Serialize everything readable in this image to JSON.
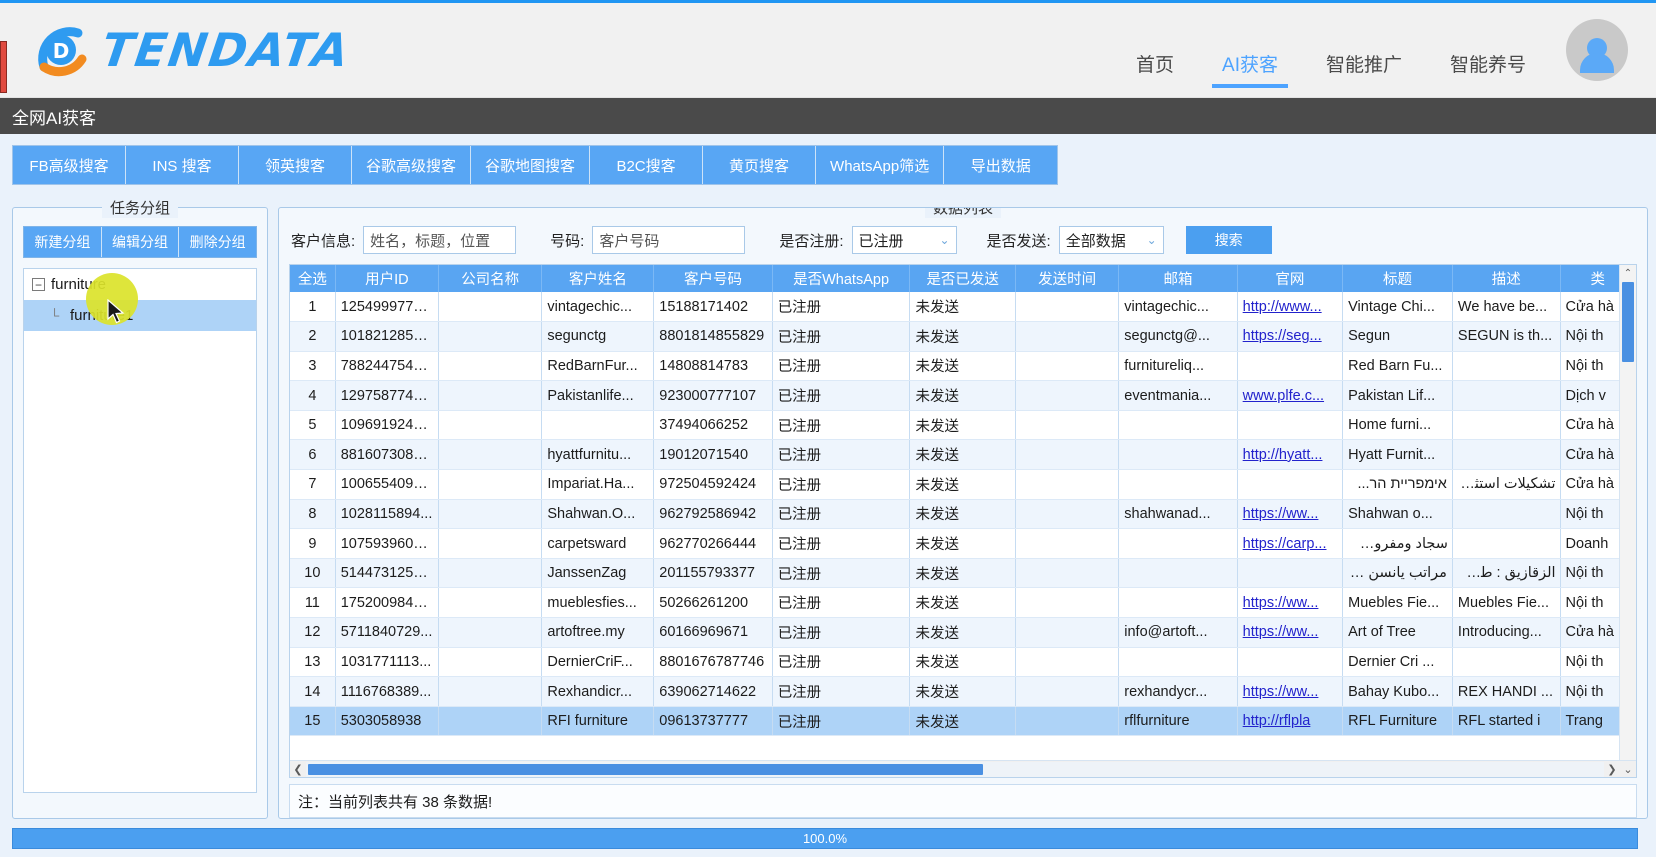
{
  "brand": {
    "name": "TENDATA",
    "logo_icon": "tendata-logo-icon"
  },
  "header": {
    "nav": [
      {
        "label": "首页",
        "active": false
      },
      {
        "label": "AI获客",
        "active": true
      },
      {
        "label": "智能推广",
        "active": false
      },
      {
        "label": "智能养号",
        "active": false
      }
    ],
    "avatar_icon": "user-avatar-icon"
  },
  "subbar": {
    "title": "全网AI获客"
  },
  "toolbar": {
    "buttons": [
      "FB高级搜客",
      "INS 搜客",
      "领英搜客",
      "谷歌高级搜客",
      "谷歌地图搜客",
      "B2C搜客",
      "黄页搜客",
      "WhatsApp筛选",
      "导出数据"
    ]
  },
  "left_panel": {
    "title": "任务分组",
    "buttons": [
      "新建分组",
      "编辑分组",
      "删除分组"
    ],
    "tree": [
      {
        "label": "furniture",
        "level": 0,
        "expanded": true,
        "selected": false,
        "toggle": "−"
      },
      {
        "label": "furniture1",
        "level": 1,
        "expanded": false,
        "selected": true,
        "toggle": ""
      }
    ]
  },
  "right_panel": {
    "title": "数据列表",
    "filters": {
      "customer_info_label": "客户信息:",
      "customer_info_placeholder": "姓名，标题，位置",
      "customer_info_value": "",
      "number_label": "号码:",
      "number_placeholder": "客户号码",
      "number_value": "",
      "registered_label": "是否注册:",
      "registered_value": "已注册",
      "sent_label": "是否发送:",
      "sent_value": "全部数据",
      "search_button": "搜索",
      "chevron_icon": "chevron-down-icon"
    },
    "columns": [
      "全选",
      "用户ID",
      "公司名称",
      "客户姓名",
      "客户号码",
      "是否WhatsApp",
      "是否已发送",
      "发送时间",
      "邮箱",
      "官网",
      "标题",
      "描述",
      "类"
    ],
    "rows": [
      {
        "idx": "1",
        "user_id": "1254999774...",
        "company": "",
        "name": "vintagechic...",
        "phone": "15188171402",
        "whatsapp": "已注册",
        "sent": "未发送",
        "send_time": "",
        "email": "vintagechic...",
        "site": "http://www...",
        "title": "Vintage Chi...",
        "desc": "We have be...",
        "cat": "Cửa hà",
        "selected": false
      },
      {
        "idx": "2",
        "user_id": "1018212852...",
        "company": "",
        "name": "segunctg",
        "phone": "8801814855829",
        "whatsapp": "已注册",
        "sent": "未发送",
        "send_time": "",
        "email": "segunctg@...",
        "site": "https://seg...",
        "title": "Segun",
        "desc": "SEGUN is th...",
        "cat": "Nội th",
        "selected": false
      },
      {
        "idx": "3",
        "user_id": "7882447549...",
        "company": "",
        "name": "RedBarnFur...",
        "phone": "14808814783",
        "whatsapp": "已注册",
        "sent": "未发送",
        "send_time": "",
        "email": "furnitureliq...",
        "site": "",
        "title": "Red Barn Fu...",
        "desc": "",
        "cat": "Nội th",
        "selected": false
      },
      {
        "idx": "4",
        "user_id": "1297587743...",
        "company": "",
        "name": "Pakistanlife...",
        "phone": "923000777107",
        "whatsapp": "已注册",
        "sent": "未发送",
        "send_time": "",
        "email": "eventmania...",
        "site": "www.plfe.c...",
        "title": "Pakistan Lif...",
        "desc": "",
        "cat": "Dịch v",
        "selected": false
      },
      {
        "idx": "5",
        "user_id": "1096919241...",
        "company": "",
        "name": "",
        "phone": "37494066252",
        "whatsapp": "已注册",
        "sent": "未发送",
        "send_time": "",
        "email": "",
        "site": "",
        "title": "Home furni...",
        "desc": "",
        "cat": "Cửa hà",
        "selected": false
      },
      {
        "idx": "6",
        "user_id": "8816073086...",
        "company": "",
        "name": "hyattfurnitu...",
        "phone": "19012071540",
        "whatsapp": "已注册",
        "sent": "未发送",
        "send_time": "",
        "email": "",
        "site": "http://hyatt...",
        "title": "Hyatt Furnit...",
        "desc": "",
        "cat": "Cửa hà",
        "selected": false
      },
      {
        "idx": "7",
        "user_id": "1006554090...",
        "company": "",
        "name": "Impariat.Ha...",
        "phone": "972504592424",
        "whatsapp": "已注册",
        "sent": "未发送",
        "send_time": "",
        "email": "",
        "site": "",
        "title": "אימפריית הר...",
        "desc": "تشكيلات استثنائية ...",
        "cat": "Cửa hà",
        "selected": false
      },
      {
        "idx": "8",
        "user_id": "1028115894...",
        "company": "",
        "name": "Shahwan.O...",
        "phone": "962792586942",
        "whatsapp": "已注册",
        "sent": "未发送",
        "send_time": "",
        "email": "shahwanad...",
        "site": "https://ww...",
        "title": "Shahwan o...",
        "desc": "",
        "cat": "Nội th",
        "selected": false
      },
      {
        "idx": "9",
        "user_id": "1075939606...",
        "company": "",
        "name": "carpetsward",
        "phone": "962770266444",
        "whatsapp": "已注册",
        "sent": "未发送",
        "send_time": "",
        "email": "",
        "site": "https://carp...",
        "title": "سجاد ومفروشات ...",
        "desc": "",
        "cat": "Doanh",
        "selected": false
      },
      {
        "idx": "10",
        "user_id": "5144731252...",
        "company": "",
        "name": "JanssenZag",
        "phone": "201155793377",
        "whatsapp": "已注册",
        "sent": "未发送",
        "send_time": "",
        "email": "",
        "site": "",
        "title": "مراتب يانسن توك...",
        "desc": "الزقازيق : طريق ...",
        "cat": "Nội th",
        "selected": false
      },
      {
        "idx": "11",
        "user_id": "1752009841...",
        "company": "",
        "name": "mueblesfies...",
        "phone": "50266261200",
        "whatsapp": "已注册",
        "sent": "未发送",
        "send_time": "",
        "email": "",
        "site": "https://ww...",
        "title": "Muebles Fie...",
        "desc": "Muebles Fie...",
        "cat": "Nội th",
        "selected": false
      },
      {
        "idx": "12",
        "user_id": "5711840729...",
        "company": "",
        "name": "artoftree.my",
        "phone": "60166969671",
        "whatsapp": "已注册",
        "sent": "未发送",
        "send_time": "",
        "email": "info@artoft...",
        "site": "https://ww...",
        "title": "Art of Tree",
        "desc": "Introducing...",
        "cat": "Cửa hà",
        "selected": false
      },
      {
        "idx": "13",
        "user_id": "1031771113...",
        "company": "",
        "name": "DernierCriF...",
        "phone": "8801676787746",
        "whatsapp": "已注册",
        "sent": "未发送",
        "send_time": "",
        "email": "",
        "site": "",
        "title": "Dernier Cri ...",
        "desc": "",
        "cat": "Nội th",
        "selected": false
      },
      {
        "idx": "14",
        "user_id": "1116768389...",
        "company": "",
        "name": "Rexhandicr...",
        "phone": "639062714622",
        "whatsapp": "已注册",
        "sent": "未发送",
        "send_time": "",
        "email": "rexhandycr...",
        "site": "https://ww...",
        "title": "Bahay Kubo...",
        "desc": "REX HANDI ...",
        "cat": "Nội th",
        "selected": false
      },
      {
        "idx": "15",
        "user_id": "5303058938",
        "company": "",
        "name": "RFI furniture",
        "phone": "09613737777",
        "whatsapp": "已注册",
        "sent": "未发送",
        "send_time": "",
        "email": "rflfurniture",
        "site": "http://rflpla",
        "title": "RFL Furniture",
        "desc": "RFL started i",
        "cat": "Trang",
        "selected": true
      }
    ],
    "note": "注：当前列表共有 38 条数据!",
    "scrollbar": {
      "h_left_icon": "chevron-left-icon",
      "h_right_icon": "chevron-right-icon",
      "v_up_icon": "chevron-up-icon",
      "v_down_icon": "chevron-down-icon"
    }
  },
  "progress": {
    "label": "100.0%",
    "percent": 100,
    "color": "#4b9ff0"
  }
}
